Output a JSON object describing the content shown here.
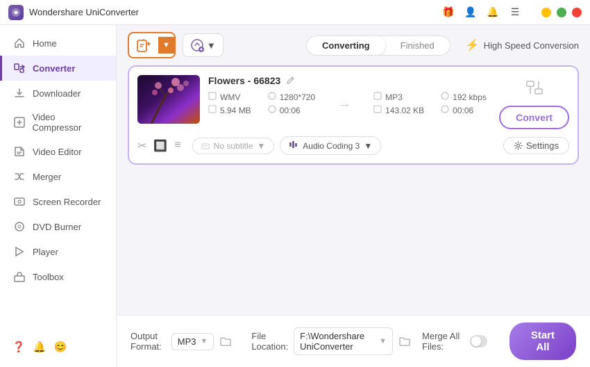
{
  "titlebar": {
    "title": "Wondershare UniConverter",
    "logo_alt": "UniConverter logo"
  },
  "sidebar": {
    "items": [
      {
        "id": "home",
        "label": "Home",
        "icon": "🏠",
        "active": false
      },
      {
        "id": "converter",
        "label": "Converter",
        "icon": "🔄",
        "active": true
      },
      {
        "id": "downloader",
        "label": "Downloader",
        "icon": "⬇️",
        "active": false
      },
      {
        "id": "video-compressor",
        "label": "Video Compressor",
        "icon": "🗜️",
        "active": false
      },
      {
        "id": "video-editor",
        "label": "Video Editor",
        "icon": "✂️",
        "active": false
      },
      {
        "id": "merger",
        "label": "Merger",
        "icon": "🔗",
        "active": false
      },
      {
        "id": "screen-recorder",
        "label": "Screen Recorder",
        "icon": "📹",
        "active": false
      },
      {
        "id": "dvd-burner",
        "label": "DVD Burner",
        "icon": "💿",
        "active": false
      },
      {
        "id": "player",
        "label": "Player",
        "icon": "▶️",
        "active": false
      },
      {
        "id": "toolbox",
        "label": "Toolbox",
        "icon": "🧰",
        "active": false
      }
    ],
    "bottom_icons": [
      "❓",
      "🔔",
      "😊"
    ]
  },
  "toolbar": {
    "add_button_icon": "📁+",
    "format_button_icon": "⚙+",
    "format_button_label": "",
    "tabs": [
      {
        "label": "Converting",
        "active": true
      },
      {
        "label": "Finished",
        "active": false
      }
    ],
    "speed_label": "High Speed Conversion"
  },
  "file_card": {
    "name": "Flowers - 66823",
    "thumbnail_alt": "Flowers video thumbnail",
    "source": {
      "format": "WMV",
      "resolution": "1280*720",
      "size": "5.94 MB",
      "duration": "00:06"
    },
    "output": {
      "format": "MP3",
      "bitrate": "192 kbps",
      "size": "143.02 KB",
      "duration": "00:06"
    },
    "subtitle_placeholder": "No subtitle",
    "audio_coding": "Audio Coding 3",
    "settings_label": "Settings",
    "convert_label": "Convert"
  },
  "bottom_bar": {
    "output_format_label": "Output Format:",
    "output_format_value": "MP3",
    "file_location_label": "File Location:",
    "file_location_value": "F:\\Wondershare UniConverter",
    "merge_label": "Merge All Files:",
    "start_all_label": "Start All"
  }
}
